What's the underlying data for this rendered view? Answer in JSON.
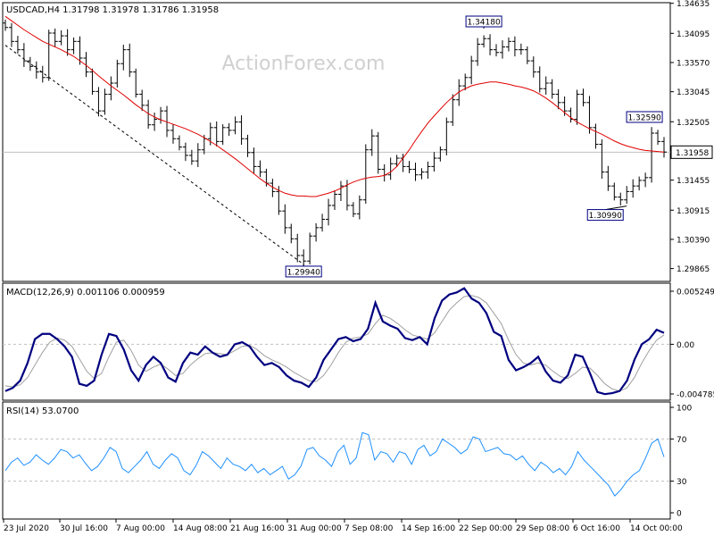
{
  "chart_data": {
    "type": "candlestick",
    "watermark": "ActionForex.com",
    "price_panel": {
      "header": "USDCAD,H4  1.31798 1.31978 1.31786 1.31958",
      "ylim": [
        1.2965,
        1.3463
      ],
      "y_ticks": [
        "1.34635",
        "1.34095",
        "1.33570",
        "1.33045",
        "1.32505",
        "1.31958",
        "1.31455",
        "1.30915",
        "1.30390",
        "1.29865"
      ],
      "current_price": "1.31958",
      "annotations": [
        {
          "label": "1.29940",
          "value": 1.2994,
          "x_index": 48
        },
        {
          "label": "1.34180",
          "value": 1.3418,
          "x_index": 77
        },
        {
          "label": "1.30990",
          "value": 1.3099,
          "x_index": 100
        },
        {
          "label": "1.32590",
          "value": 1.3259,
          "x_index": 104
        }
      ],
      "trendline": {
        "from": {
          "x_index": 0,
          "value": 1.3388
        },
        "to": {
          "x_index": 48,
          "value": 1.2994
        }
      },
      "close": [
        1.342,
        1.3395,
        1.338,
        1.336,
        1.335,
        1.334,
        1.333,
        1.341,
        1.3395,
        1.3405,
        1.338,
        1.3395,
        1.3365,
        1.334,
        1.3305,
        1.327,
        1.33,
        1.332,
        1.3355,
        1.338,
        1.334,
        1.33,
        1.328,
        1.3245,
        1.3255,
        1.327,
        1.3235,
        1.322,
        1.3205,
        1.319,
        1.318,
        1.32,
        1.322,
        1.324,
        1.3215,
        1.324,
        1.3235,
        1.325,
        1.322,
        1.3195,
        1.317,
        1.316,
        1.314,
        1.3125,
        1.309,
        1.306,
        1.304,
        1.301,
        1.3,
        1.3045,
        1.306,
        1.3075,
        1.31,
        1.312,
        1.3135,
        1.31,
        1.3085,
        1.311,
        1.32,
        1.3225,
        1.3165,
        1.3155,
        1.3175,
        1.3185,
        1.317,
        1.3165,
        1.3155,
        1.316,
        1.317,
        1.3185,
        1.32,
        1.325,
        1.329,
        1.3315,
        1.333,
        1.336,
        1.339,
        1.34,
        1.338,
        1.3375,
        1.3385,
        1.3395,
        1.338,
        1.338,
        1.336,
        1.334,
        1.331,
        1.332,
        1.33,
        1.3285,
        1.327,
        1.3255,
        1.33,
        1.3285,
        1.324,
        1.321,
        1.316,
        1.3135,
        1.3115,
        1.311,
        1.3125,
        1.3135,
        1.3145,
        1.315,
        1.323,
        1.3215,
        1.3196
      ],
      "ma": [
        1.344,
        1.3432,
        1.3424,
        1.3416,
        1.3409,
        1.3402,
        1.3395,
        1.339,
        1.3385,
        1.338,
        1.3374,
        1.3368,
        1.336,
        1.3352,
        1.3343,
        1.3333,
        1.3324,
        1.3315,
        1.3307,
        1.3299,
        1.329,
        1.3281,
        1.3273,
        1.3265,
        1.3259,
        1.3254,
        1.325,
        1.3246,
        1.3242,
        1.3238,
        1.3233,
        1.3228,
        1.3222,
        1.3215,
        1.3208,
        1.32,
        1.3192,
        1.3184,
        1.3175,
        1.3166,
        1.3157,
        1.3148,
        1.314,
        1.3133,
        1.3127,
        1.3122,
        1.3119,
        1.3117,
        1.3117,
        1.3116,
        1.3116,
        1.3119,
        1.3122,
        1.3126,
        1.3131,
        1.3137,
        1.3142,
        1.3146,
        1.3149,
        1.3151,
        1.3152,
        1.3154,
        1.316,
        1.317,
        1.3185,
        1.32,
        1.3217,
        1.3233,
        1.3248,
        1.3261,
        1.3273,
        1.3285,
        1.3295,
        1.3304,
        1.331,
        1.3315,
        1.3318,
        1.332,
        1.3322,
        1.3322,
        1.332,
        1.3318,
        1.3315,
        1.3313,
        1.331,
        1.3306,
        1.33,
        1.3293,
        1.3285,
        1.3276,
        1.3267,
        1.3258,
        1.325,
        1.3244,
        1.3238,
        1.3233,
        1.3228,
        1.3222,
        1.3216,
        1.3211,
        1.3207,
        1.3204,
        1.3201,
        1.3199,
        1.3198,
        1.3197,
        1.3196
      ]
    },
    "macd_panel": {
      "header": "MACD(12,26,9) 0.001106 0.000959",
      "ylim": [
        -0.0053,
        0.0058
      ],
      "y_ticks": [
        "0.005249",
        "0.00",
        "-0.004785"
      ],
      "macd": [
        -0.0045,
        -0.0042,
        -0.0035,
        -0.0018,
        0.0005,
        0.001,
        0.001,
        0.0005,
        -0.0002,
        -0.0012,
        -0.0038,
        -0.004,
        -0.0035,
        -0.001,
        0.001,
        0.0008,
        -0.0005,
        -0.0025,
        -0.0035,
        -0.002,
        -0.0012,
        -0.0018,
        -0.0032,
        -0.0036,
        -0.0018,
        -0.0008,
        -0.001,
        -0.0002,
        -0.0008,
        -0.0012,
        -0.001,
        0.0,
        0.0002,
        -0.0002,
        -0.0012,
        -0.002,
        -0.0018,
        -0.0022,
        -0.003,
        -0.0035,
        -0.0037,
        -0.0041,
        -0.0032,
        -0.0015,
        -0.0005,
        0.0005,
        0.0007,
        0.0003,
        0.0005,
        0.0015,
        0.004,
        0.0022,
        0.0018,
        0.0015,
        0.0006,
        0.0004,
        0.0007,
        0.0,
        0.0025,
        0.0042,
        0.0048,
        0.005,
        0.0054,
        0.0044,
        0.004,
        0.003,
        0.0012,
        0.0008,
        -0.0015,
        -0.0025,
        -0.0022,
        -0.0018,
        -0.0012,
        -0.0026,
        -0.0035,
        -0.0037,
        -0.003,
        -0.001,
        -0.0012,
        -0.0028,
        -0.0046,
        -0.0048,
        -0.0047,
        -0.0045,
        -0.0035,
        -0.0015,
        0.0,
        0.0005,
        0.0014,
        0.0011
      ],
      "signal": [
        -0.004,
        -0.0041,
        -0.0039,
        -0.0032,
        -0.002,
        -0.0008,
        0.0002,
        0.0006,
        0.0004,
        -0.0002,
        -0.0014,
        -0.0026,
        -0.0033,
        -0.0028,
        -0.0012,
        0.0002,
        0.0004,
        -0.0006,
        -0.002,
        -0.0026,
        -0.0022,
        -0.0019,
        -0.0024,
        -0.003,
        -0.0028,
        -0.002,
        -0.0014,
        -0.0009,
        -0.0008,
        -0.0009,
        -0.001,
        -0.0006,
        -0.0002,
        -0.0001,
        -0.0005,
        -0.0011,
        -0.0015,
        -0.0018,
        -0.0022,
        -0.0027,
        -0.0031,
        -0.0035,
        -0.0036,
        -0.003,
        -0.002,
        -0.0008,
        0.0002,
        0.0006,
        0.0007,
        0.001,
        0.002,
        0.0028,
        0.0025,
        0.002,
        0.0014,
        0.0009,
        0.0007,
        0.0005,
        0.0011,
        0.0022,
        0.0033,
        0.004,
        0.0046,
        0.0047,
        0.0045,
        0.004,
        0.003,
        0.002,
        0.0004,
        -0.001,
        -0.0018,
        -0.002,
        -0.0018,
        -0.002,
        -0.0026,
        -0.0031,
        -0.0033,
        -0.0028,
        -0.0022,
        -0.0023,
        -0.003,
        -0.0038,
        -0.0043,
        -0.0045,
        -0.0042,
        -0.0032,
        -0.0018,
        -0.0006,
        0.0004,
        0.0009
      ]
    },
    "rsi_panel": {
      "header": "RSI(14) 53.0700",
      "ylim": [
        0,
        100
      ],
      "y_ticks": [
        "100",
        "70",
        "30",
        "0"
      ],
      "levels": [
        70,
        30
      ],
      "rsi": [
        40,
        48,
        52,
        45,
        48,
        55,
        50,
        46,
        52,
        60,
        58,
        52,
        55,
        47,
        40,
        44,
        52,
        62,
        58,
        42,
        38,
        44,
        50,
        58,
        46,
        42,
        50,
        56,
        52,
        40,
        36,
        45,
        58,
        54,
        48,
        42,
        52,
        46,
        44,
        40,
        46,
        38,
        42,
        36,
        40,
        44,
        32,
        36,
        44,
        60,
        62,
        54,
        50,
        44,
        58,
        64,
        46,
        52,
        76,
        74,
        50,
        58,
        56,
        48,
        58,
        56,
        46,
        60,
        64,
        54,
        58,
        70,
        66,
        62,
        56,
        60,
        72,
        70,
        58,
        60,
        62,
        56,
        55,
        50,
        54,
        46,
        40,
        48,
        44,
        38,
        42,
        36,
        44,
        58,
        50,
        44,
        38,
        32,
        26,
        16,
        22,
        30,
        36,
        40,
        52,
        66,
        70,
        53
      ]
    },
    "x_labels": [
      "23 Jul 2020",
      "30 Jul 16:00",
      "7 Aug 00:00",
      "14 Aug 08:00",
      "21 Aug 16:00",
      "31 Aug 00:00",
      "7 Sep 08:00",
      "14 Sep 16:00",
      "22 Sep 00:00",
      "29 Sep 08:00",
      "6 Oct 16:00",
      "14 Oct 00:00"
    ],
    "colors": {
      "candle": "#000000",
      "ma": "#e00000",
      "macd": "#000080",
      "signal": "#a0a0a0",
      "rsi": "#1e90ff",
      "grid": "#c0c0c0",
      "label_box": "#000080"
    }
  }
}
